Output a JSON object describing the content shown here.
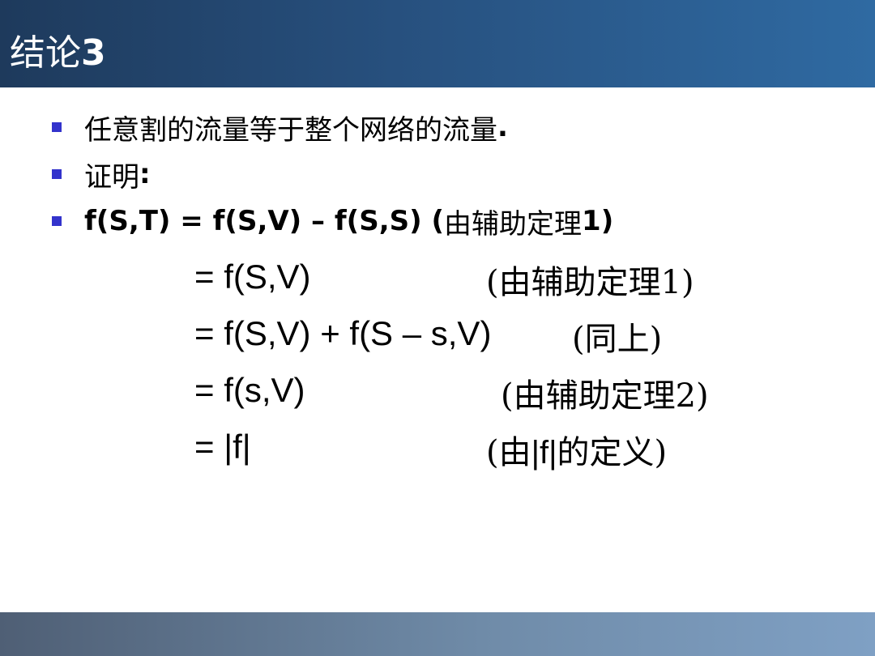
{
  "slide": {
    "title_text": "结论",
    "title_num": "3"
  },
  "bullets": [
    {
      "text": "任意割的流量等于整个网络的流量",
      "suffix": "."
    },
    {
      "text": "证明",
      "suffix": ":"
    },
    {
      "formula": "f(S,T) = f(S,V) – f(S,S) (",
      "note": "由辅助定理",
      "note_end": "1)"
    }
  ],
  "equations": [
    {
      "lhs": "= f(S,V)",
      "note": "(由辅助定理1)"
    },
    {
      "lhs": "= f(S,V) + f(S – s,V)",
      "note": "(同上)"
    },
    {
      "lhs": "= f(s,V)",
      "note": "(由辅助定理2)"
    },
    {
      "lhs": "= |f|",
      "note_open": "(由",
      "note_mid": "|f|",
      "note_close": "的定义)"
    }
  ],
  "colors": {
    "header_start": "#1e3a5c",
    "header_end": "#2f6aa2",
    "bullet": "#3333cc",
    "footer_start": "#4f5f75",
    "footer_end": "#7fa0c4"
  }
}
